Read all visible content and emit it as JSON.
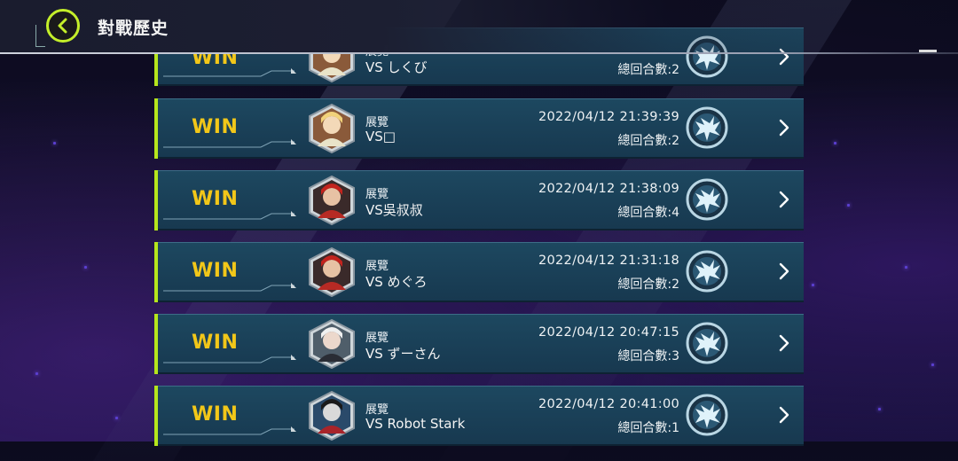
{
  "header": {
    "title": "對戰歷史"
  },
  "icons": {
    "back": "chevron-left-icon",
    "row_arrow": "chevron-right-icon",
    "rank": "rank-emblem-icon"
  },
  "colors": {
    "accent": "#c4ef2a",
    "win": "#f2c719",
    "row_bg": "#1d4860"
  },
  "matches": [
    {
      "result": "WIN",
      "mode": "展覽",
      "opponent": "VS しくび",
      "datetime": "",
      "turns": "總回合數:2",
      "avatar": "blonde-girl"
    },
    {
      "result": "WIN",
      "mode": "展覽",
      "opponent": "VS□",
      "datetime": "2022/04/12 21:39:39",
      "turns": "總回合數:2",
      "avatar": "blonde-girl"
    },
    {
      "result": "WIN",
      "mode": "展覽",
      "opponent": "VS吳叔叔",
      "datetime": "2022/04/12 21:38:09",
      "turns": "總回合數:4",
      "avatar": "red-cap"
    },
    {
      "result": "WIN",
      "mode": "展覽",
      "opponent": "VS めぐろ",
      "datetime": "2022/04/12 21:31:18",
      "turns": "總回合數:2",
      "avatar": "red-cap"
    },
    {
      "result": "WIN",
      "mode": "展覽",
      "opponent": "VS ずーさん",
      "datetime": "2022/04/12 20:47:15",
      "turns": "總回合數:3",
      "avatar": "white-hair"
    },
    {
      "result": "WIN",
      "mode": "展覽",
      "opponent": "VS Robot Stark",
      "datetime": "2022/04/12 20:41:00",
      "turns": "總回合數:1",
      "avatar": "masked"
    }
  ]
}
